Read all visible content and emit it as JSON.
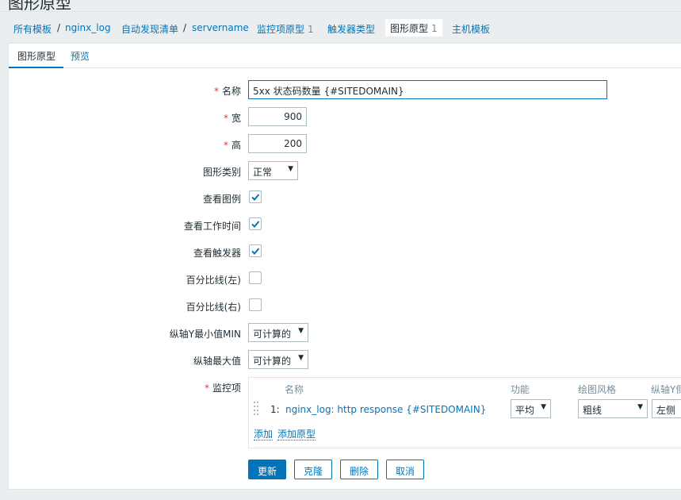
{
  "page": {
    "title": "图形原型"
  },
  "breadcrumbs": [
    {
      "label": "所有模板"
    },
    {
      "label": "nginx_log"
    },
    {
      "label": "自动发现清单"
    },
    {
      "label": "servername"
    },
    {
      "label": "监控项原型",
      "count": "1"
    },
    {
      "label": "触发器类型"
    },
    {
      "label": "图形原型",
      "count": "1"
    },
    {
      "label": "主机模板"
    }
  ],
  "separators": [
    "/",
    "/",
    "/"
  ],
  "tabs": {
    "graph_prototype": "图形原型",
    "preview": "预览"
  },
  "form": {
    "required_mark": "*",
    "name": {
      "label": "名称",
      "value": "5xx 状态码数量 {#SITEDOMAIN}"
    },
    "width": {
      "label": "宽",
      "value": "900"
    },
    "height": {
      "label": "高",
      "value": "200"
    },
    "graph_type": {
      "label": "图形类别",
      "value": "正常"
    },
    "show_legend": {
      "label": "查看图例",
      "checked": true
    },
    "show_working_time": {
      "label": "查看工作时间",
      "checked": true
    },
    "show_triggers": {
      "label": "查看触发器",
      "checked": true
    },
    "percentile_left": {
      "label": "百分比线(左)",
      "checked": false
    },
    "percentile_right": {
      "label": "百分比线(右)",
      "checked": false
    },
    "y_min": {
      "label": "纵轴Y最小值MIN",
      "value": "可计算的"
    },
    "y_max": {
      "label": "纵轴最大值",
      "value": "可计算的"
    },
    "items": {
      "label": "监控项",
      "headers": {
        "name": "名称",
        "function": "功能",
        "draw_style": "绘图风格",
        "y_axis": "纵轴Y侧"
      },
      "rows": [
        {
          "index": "1:",
          "name": "nginx_log: http response {#SITEDOMAIN}",
          "function": "平均",
          "draw_style": "粗线",
          "y_axis": "左侧"
        }
      ],
      "add": "添加",
      "add_prototype": "添加原型"
    }
  },
  "buttons": {
    "update": "更新",
    "clone": "克隆",
    "delete": "删除",
    "cancel": "取消"
  },
  "colors": {
    "accent": "#0275b8",
    "required": "#e33734",
    "background": "#ebeef0"
  },
  "icons": {
    "checkbox_checked": "check-icon",
    "select": "chevron-down-icon",
    "drag": "drag-handle-icon"
  }
}
